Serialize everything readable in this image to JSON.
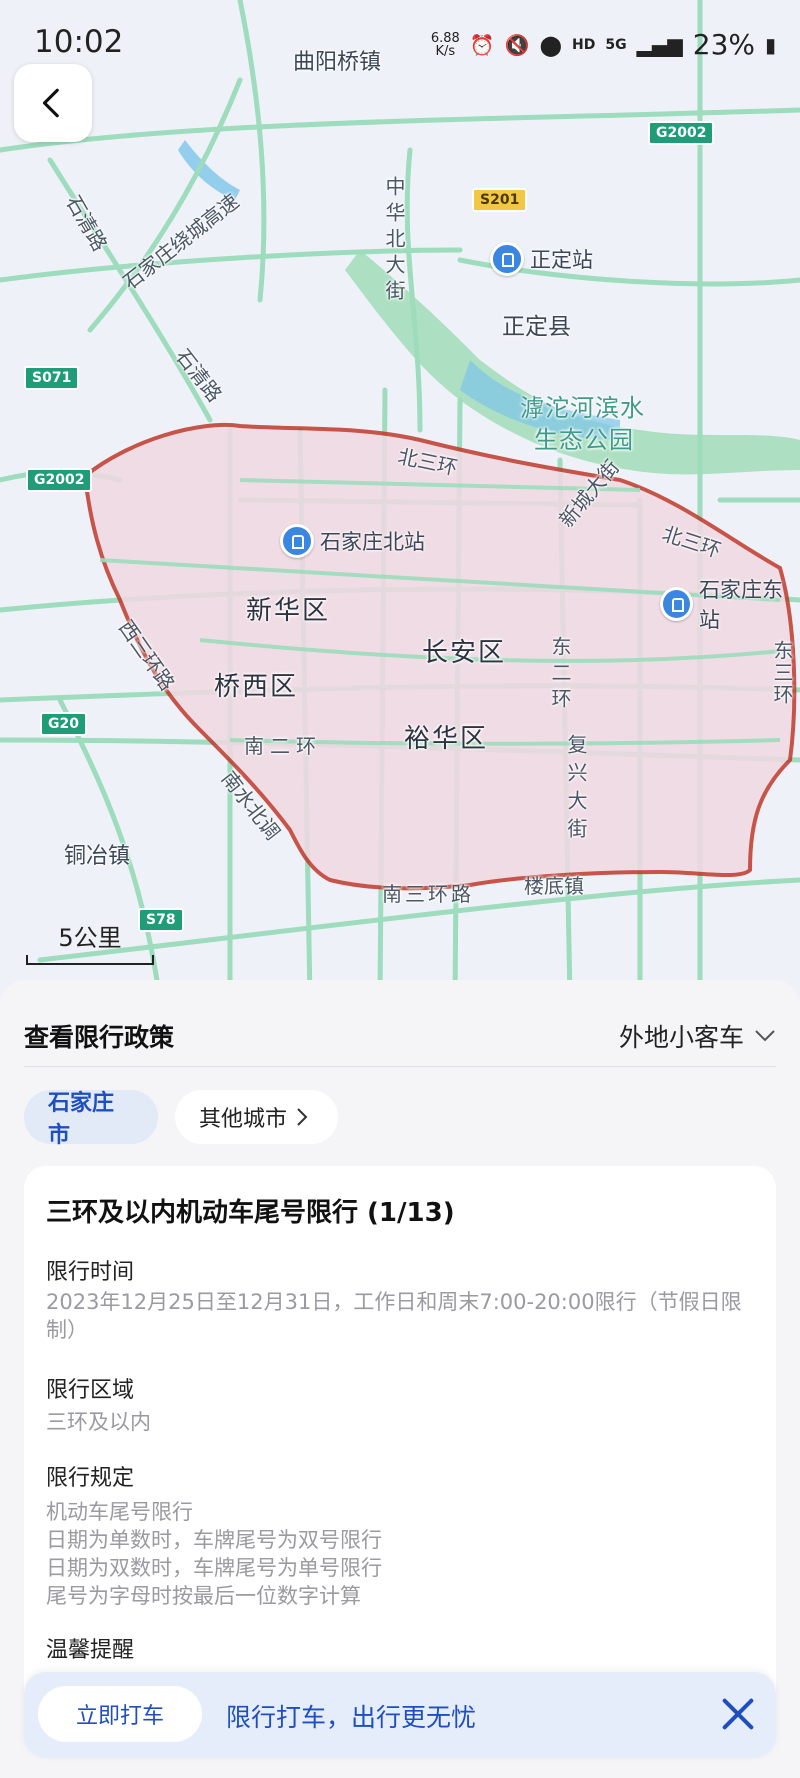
{
  "status_bar": {
    "time": "10:02",
    "net_speed_value": "6.88",
    "net_speed_unit": "K/s",
    "hd": "HD",
    "network": "5G",
    "battery": "23%"
  },
  "map": {
    "district_labels": [
      "新华区",
      "长安区",
      "桥西区",
      "裕华区"
    ],
    "place_labels": [
      "曲阳桥镇",
      "正定县",
      "铜冶镇",
      "楼底镇"
    ],
    "park_label_line1": "滹沱河滨水",
    "park_label_line2": "生态公园",
    "stations": [
      "正定站",
      "石家庄北站",
      "石家庄东站"
    ],
    "road_labels": [
      "北三环",
      "北三环",
      "西三环路",
      "南二环",
      "南三环路",
      "东二环",
      "复兴大街",
      "新城大街",
      "中华北大街",
      "石清路",
      "石清路",
      "石家庄绕城高速",
      "南水北调",
      "东三环"
    ],
    "shields": [
      "G2002",
      "G2002",
      "S201",
      "S071",
      "G20",
      "S78"
    ],
    "scale_label": "5公里"
  },
  "sheet": {
    "title": "查看限行政策",
    "vehicle_type": "外地小客车",
    "city_chip": "石家庄市",
    "other_city_chip": "其他城市"
  },
  "policy_card": {
    "title": "三环及以内机动车尾号限行 (1/13)",
    "time_heading": "限行时间",
    "time_body": "2023年12月25日至12月31日，工作日和周末7:00-20:00限行（节假日限制）",
    "area_heading": "限行区域",
    "area_body": "三环及以内",
    "rule_heading": "限行规定",
    "rule_lines": [
      "机动车尾号限行",
      "日期为单数时，车牌尾号为双号限行",
      "日期为双数时，车牌尾号为单号限行",
      "尾号为字母时按最后一位数字计算"
    ],
    "tips_heading": "温馨提醒"
  },
  "promo": {
    "button": "立即打车",
    "text": "限行打车，出行更无忧"
  },
  "colors": {
    "accent": "#1f4fbf",
    "restriction_border": "#c0392b",
    "restriction_fill": "#f1d9e2",
    "road": "#8fd6b3"
  }
}
